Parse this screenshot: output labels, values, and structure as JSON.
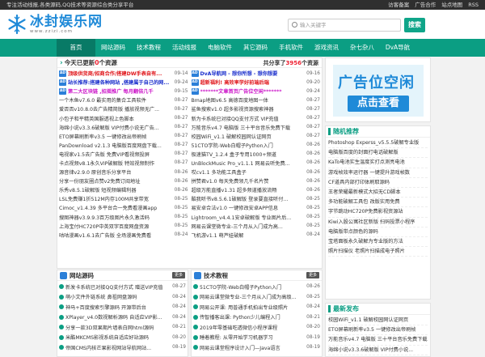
{
  "topbar": {
    "left": "专注活动线报,各类源码,QQ技术等资源综合类分享平台",
    "links": [
      "访客备案",
      "广告合作",
      "站点地图",
      "RSS"
    ]
  },
  "logo": {
    "title": "冰封娱乐网",
    "subtitle": "www.zzizi.com"
  },
  "search": {
    "placeholder": "输入关键字",
    "button": "搜索"
  },
  "nav": [
    "首页",
    "网站源码",
    "技术教程",
    "活动线报",
    "电脑软件",
    "其它源码",
    "手机软件",
    "游戏资讯",
    "杂七杂八",
    "DvA导航"
  ],
  "updates": {
    "title_prefix": "今天已更新",
    "title_count": "0",
    "title_suffix": "个资源",
    "share_prefix": "共分享了",
    "share_count": "3956",
    "share_suffix": "个资源",
    "left": [
      {
        "badge": "AD",
        "text": "顶级供货商/招商合作/搭建DW手表自有...",
        "date": "09-14",
        "color": "#e0161b"
      },
      {
        "badge": "AD",
        "text": "站长推荐:搭建各种网站 ,搭建属于自己的网...",
        "date": "09-24",
        "color": "#1a2ecc"
      },
      {
        "badge": "AD",
        "text": "第二大区块链 ,招摇推广 每月翻倍几千",
        "date": "09-15",
        "color": "#cc16c9"
      },
      {
        "badge": "",
        "text": "一个木鱼v7.6.0 最实用的集合工具软件",
        "date": "08-27"
      },
      {
        "badge": "",
        "text": "爱否否v10.8.0去广告精简版 播放视频无广...",
        "date": "08-27"
      },
      {
        "badge": "",
        "text": "小包子和平精英国服透视上色脚本",
        "date": "08-27"
      },
      {
        "badge": "",
        "text": "海绵小说v3.3.6破解版 VIP付费小说无广告...",
        "date": "08-27"
      },
      {
        "badge": "",
        "text": "ETO屏幕刷新率v3.5 一键修改出帝刷帧",
        "date": "08-27"
      },
      {
        "badge": "",
        "text": "PanDownload v2.1.3 电脑版百度网盘下载...",
        "date": "08-27"
      },
      {
        "badge": "",
        "text": "电视家v1.5去广告版 免费VIP看视频投屏",
        "date": "08-27"
      },
      {
        "badge": "",
        "text": "卡点视频v8.1永久VIP破解版 特效视频制作",
        "date": "08-27"
      },
      {
        "badge": "",
        "text": "源音律v2.9.0 原创音乐分享平台",
        "date": "08-26"
      },
      {
        "badge": "",
        "text": "分享一份朋友圈点赞v2免费订阅地址",
        "date": "08-26"
      },
      {
        "badge": "",
        "text": "乐秀v8.5.1破解版 短视频编辑利器",
        "date": "08-26"
      },
      {
        "badge": "",
        "text": "LSL免费赚1折512M内存100M共享带宽",
        "date": "08-25"
      },
      {
        "badge": "",
        "text": "Cimoc_v1.4.39 多平台合一免费看漫画app",
        "date": "08-25"
      },
      {
        "badge": "",
        "text": "搜图神器v3.9.9.3百万级图片永久激活码",
        "date": "08-25"
      },
      {
        "badge": "",
        "text": "上海宝付HC720P中英双字百度网盘资源",
        "date": "08-25"
      },
      {
        "badge": "",
        "text": "咕咕漫画v1.6.1去广告版 全场漫画免费看",
        "date": "08-24"
      }
    ],
    "right": [
      {
        "badge": "AD",
        "text": "DvA导航网 - 想你所想 - 想你想要",
        "date": "09-16",
        "color": "#1a2ecc"
      },
      {
        "badge": "AD",
        "text": "超新福利!  高效率学好前端后端",
        "date": "09-20",
        "color": "#e0161b"
      },
      {
        "badge": "AD",
        "text": "*******文章首页广告位空闲*******",
        "date": "09-24",
        "color": "#cc16c9"
      },
      {
        "badge": "",
        "text": "Bmap地图v6.5 高德百度地图一体",
        "date": "08-27"
      },
      {
        "badge": "",
        "text": "鲨鱼搜索v1.0 超多影视资源搜索神器",
        "date": "08-27"
      },
      {
        "badge": "",
        "text": "新为卡系统已对接QQ支付方式 VIP充值",
        "date": "08-27"
      },
      {
        "badge": "",
        "text": "万能音乐v4.7 电脑版 三十平台音乐免费下载",
        "date": "08-27"
      },
      {
        "badge": "",
        "text": "校园WiFi_v1.1 破解校园网认证网页",
        "date": "08-27"
      },
      {
        "badge": "",
        "text": "51CTO学院-Web白帽子Python入门",
        "date": "08-26"
      },
      {
        "badge": "",
        "text": "极速猫TV_1.2.4 盒子专用1000+频道",
        "date": "08-26"
      },
      {
        "badge": "",
        "text": "UnBlockMusic Pro_v1.1.1 网易云听免费...",
        "date": "08-26"
      },
      {
        "badge": "",
        "text": "哎cv1.1 多功能工具盒子",
        "date": "08-26"
      },
      {
        "badge": "",
        "text": "拼赞君v1.0 每天免费领几千名片赞",
        "date": "08-26"
      },
      {
        "badge": "",
        "text": "超级万能直播v1.31 超多频道播放流畅",
        "date": "08-26"
      },
      {
        "badge": "",
        "text": "酷我听书v8.5.6.1破解版 登录要直接听付...",
        "date": "08-25"
      },
      {
        "badge": "",
        "text": "易安卓合法v1.0 一键修改安卓APP信息",
        "date": "08-25"
      },
      {
        "badge": "",
        "text": "Lightroom_v4.4.1安卓破解版 专业图片后...",
        "date": "08-25"
      },
      {
        "badge": "",
        "text": "网易云课堂微专业-三个月从入门成为高...",
        "date": "08-25"
      },
      {
        "badge": "",
        "text": "飞机游v1.1 萌芦娃破解",
        "date": "08-24"
      }
    ]
  },
  "source_section": {
    "title": "网站源码",
    "more": "更多",
    "items": [
      {
        "text": "新发卡系统已对接QQ支付方式 赠送VIP充值",
        "date": "08-27"
      },
      {
        "text": "萌小文件外链系统 鼻祖网盘源码",
        "date": "08-24"
      },
      {
        "text": "神马+百度搜索引擎源码 开源带后台",
        "date": "08-24"
      },
      {
        "text": "XPlayer_v4.0数视解析源码 自适应VIP影...",
        "date": "08-24"
      },
      {
        "text": "分享一款3D双果期片墙表白网html源码",
        "date": "08-21"
      },
      {
        "text": "米酷MKCMS影视系统自适应好站源码",
        "date": "08-20"
      },
      {
        "text": "帝国CMS内核芒果影视网站导航网站...",
        "date": "08-19"
      }
    ]
  },
  "tutorial_section": {
    "title": "技术教程",
    "more": "更多",
    "items": [
      {
        "text": "51CTO学院-Web白帽子Python入门",
        "date": "08-26"
      },
      {
        "text": "网易云课堂微专业-三个月从入门成为高级...",
        "date": "08-25"
      },
      {
        "text": "网易公开课: 用普通手机拍出专业级照片",
        "date": "08-24"
      },
      {
        "text": "传智播客出课: Python少儿编程入门",
        "date": "08-21"
      },
      {
        "text": "2019年零基础吃透微信小程序课程",
        "date": "08-20"
      },
      {
        "text": "睡着教程: 从零开始学习机器学习",
        "date": "08-19"
      },
      {
        "text": "网易云课堂程序设计入门—Java语言",
        "date": "08-19"
      }
    ]
  },
  "ad": {
    "line1": "广告位空闲",
    "line2": "点击查看"
  },
  "random": {
    "title": "随机推荐",
    "items": [
      "Photoshop Experss_v5.5.5破解专业版",
      "电脑版百度的封面打电话破解版",
      "KaTo电池实生温度实打点测亮电池",
      "游戏帧效率运行器 一键提升游戏帧数",
      "CF道具内部打印体刷取源码",
      "王者荣耀最新模式大招无CD脚本",
      "多功能破解工具包 改版实用免费",
      "字节跳动HC720P免费影视资源站",
      "Kiwi入股公寓社区新版 扫码投票小程序",
      "电脑版带点颜色的源码",
      "宝塔面板永久破解为专业版的方法",
      "照片扫描仪 老照片扫描成电子照片"
    ]
  },
  "latest": {
    "title": "最新发布",
    "items": [
      "校园WiFi_v1.1 破解校园网认证网页",
      "ETO屏幕刷新率v3.5 一键修改出帝刷帧",
      "万能音乐v4.7 电脑版 三十平台音乐免费下载",
      "海绵小说v3.3.6破解版 VIP付费小说..."
    ]
  }
}
